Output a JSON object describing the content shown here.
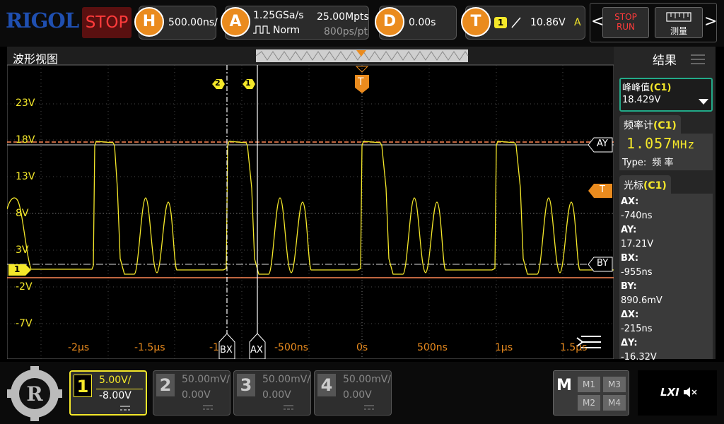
{
  "brand": "RIGOL",
  "run_state": "STOP",
  "horizontal": {
    "icon": "H",
    "scale": "500.00ns/"
  },
  "acquire": {
    "icon": "A",
    "sample_rate": "1.25GSa/s",
    "mode": "Norm",
    "memory_depth": "25.00Mpts",
    "resolution": "800ps/pt"
  },
  "delay": {
    "icon": "D",
    "value": "0.00s"
  },
  "trigger": {
    "icon": "T",
    "source_badge": "1",
    "level": "10.86V",
    "coupling": "A"
  },
  "topright": {
    "prev": "<",
    "next": ">",
    "stop_label": "STOP",
    "run_label": "RUN",
    "measure_label": "测量"
  },
  "waveform": {
    "title": "波形视图",
    "y_labels": [
      "23V",
      "18V",
      "13V",
      "8V",
      "3V",
      "-2V",
      "-7V"
    ],
    "x_labels": [
      "-2μs",
      "-1.5μs",
      "-1",
      "-500ns",
      "0s",
      "500ns",
      "1μs",
      "1.5μs"
    ],
    "cursor_labels": {
      "ax": "AX",
      "bx": "BX",
      "ay": "AY",
      "by": "BY"
    },
    "markers": {
      "ch1": "1",
      "trig": "T",
      "b2": "2",
      "b1": "1"
    }
  },
  "results": {
    "title": "结果",
    "peak": {
      "label": "峰峰值",
      "src": "(C1)",
      "value": "18.429V"
    },
    "freq": {
      "label": "频率计",
      "src": "(C1)",
      "value": "1.057",
      "unit": "MHz",
      "type_label": "Type:",
      "type_value": "频 率"
    },
    "cursor": {
      "label": "光标",
      "src": "(C1)",
      "items": [
        {
          "k": "AX:",
          "v": "-740ns"
        },
        {
          "k": "AY:",
          "v": "17.21V"
        },
        {
          "k": "BX:",
          "v": "-955ns"
        },
        {
          "k": "BY:",
          "v": "890.6mV"
        },
        {
          "k": "ΔX:",
          "v": "-215ns"
        },
        {
          "k": "ΔY:",
          "v": "-16.32V"
        }
      ]
    }
  },
  "channels": [
    {
      "num": "1",
      "scale": "5.00V/",
      "offset": "-8.00V",
      "active": true
    },
    {
      "num": "2",
      "scale": "50.00mV/",
      "offset": "0.00V",
      "active": false
    },
    {
      "num": "3",
      "scale": "50.00mV/",
      "offset": "0.00V",
      "active": false
    },
    {
      "num": "4",
      "scale": "50.00mV/",
      "offset": "0.00V",
      "active": false
    }
  ],
  "math": {
    "label": "M",
    "items": [
      "M1",
      "M3",
      "M2",
      "M4"
    ]
  },
  "lxi": "LXI",
  "colors": {
    "ch1": "#f5e82a",
    "accent": "#ea8b1e",
    "cursor_h": "#ff8855",
    "panel_border": "#22aa88"
  }
}
